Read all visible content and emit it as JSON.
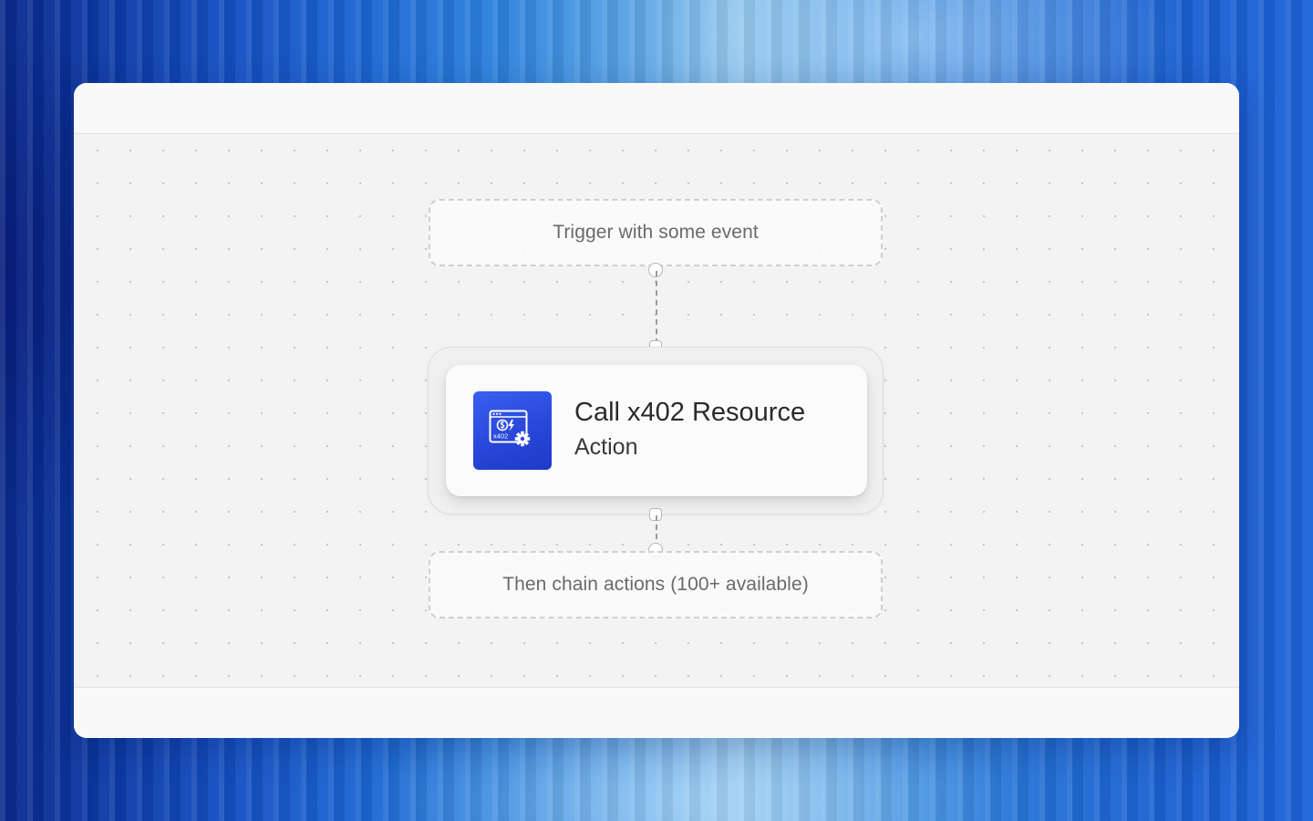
{
  "workflow": {
    "trigger": {
      "label": "Trigger with some event"
    },
    "action": {
      "title": "Call x402 Resource",
      "subtitle": "Action",
      "icon": "x402-resource-icon",
      "icon_text": "x402",
      "icon_color": "#2f51e4"
    },
    "chain": {
      "label": "Then chain actions (100+ available)"
    }
  }
}
